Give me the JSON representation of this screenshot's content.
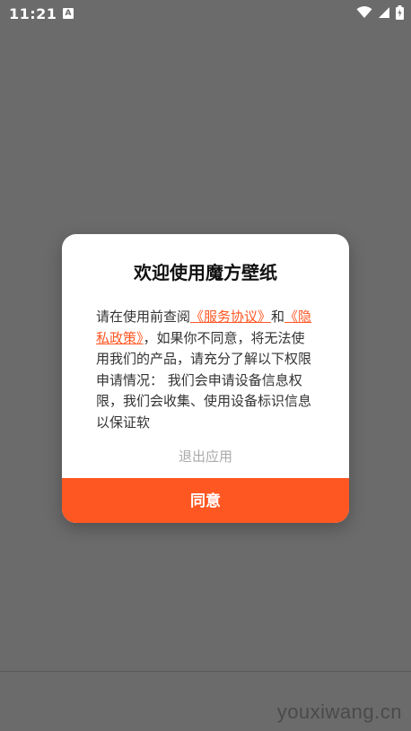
{
  "status_bar": {
    "time": "11:21",
    "notification_icon": "A"
  },
  "dialog": {
    "title": "欢迎使用魔方壁纸",
    "body": {
      "text_1": "请在使用前查阅",
      "link_service": "《服务协议》",
      "text_2": "和",
      "link_privacy": "《隐私政策》",
      "text_3": "，如果你不同意，将无法使用我们的产品，请充分了解以下权限申请情况： 我们会申请设备信息权限，我们会收集、使用设备标识信息以保证软"
    },
    "exit_label": "退出应用",
    "agree_label": "同意"
  },
  "watermark": "youxiwang.cn",
  "colors": {
    "accent": "#ff5722",
    "overlay": "#6b6b6b"
  }
}
